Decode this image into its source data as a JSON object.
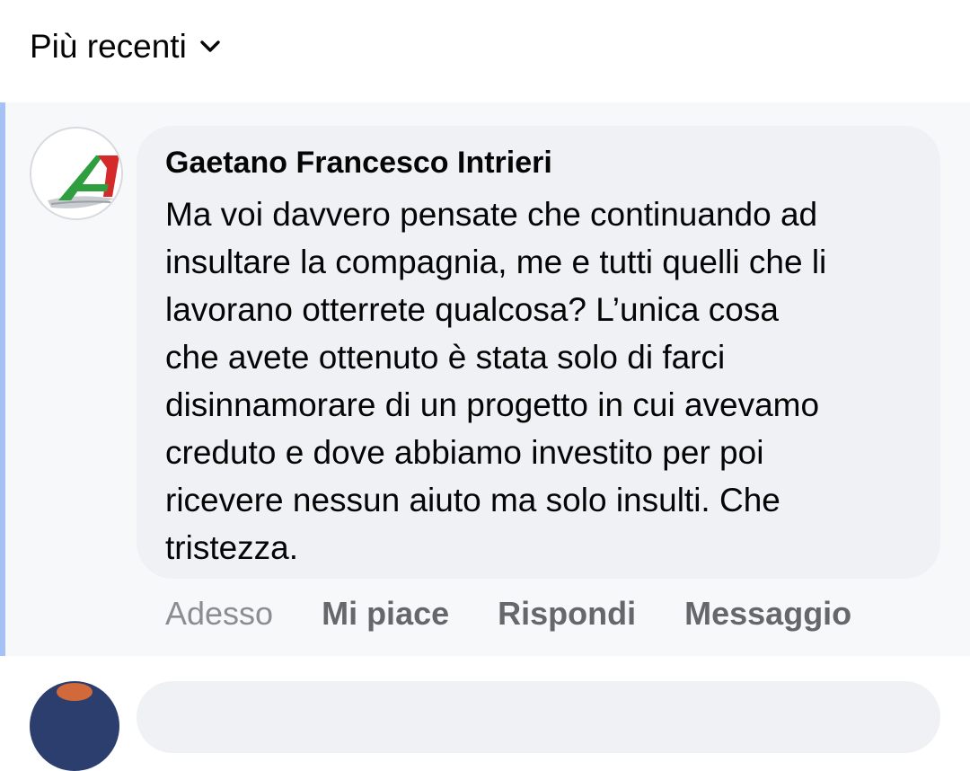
{
  "sort": {
    "label": "Più recenti",
    "icon": "chevron-down-icon"
  },
  "comment": {
    "author": "Gaetano Francesco Intrieri",
    "avatar_icon": "airline-tail-logo",
    "text": "Ma voi davvero pensate che continuando ad\ninsultare la compagnia, me e tutti quelli che li\nlavorano otterrete qualcosa? L’unica cosa\nche avete ottenuto è stata solo di farci\ndisinnamorare di un progetto in cui avevamo\ncreduto e dove abbiamo investito per poi\nricevere nessun aiuto ma solo insulti. Che\ntristezza.",
    "timestamp": "Adesso",
    "actions": {
      "like": "Mi piace",
      "reply": "Rispondi",
      "message": "Messaggio"
    }
  },
  "colors": {
    "highlight_bar": "#a6c2f4",
    "bubble": "#eff1f4",
    "secondary_text": "#65676b",
    "logo_green": "#2e9e3e",
    "logo_red": "#d42a2a"
  }
}
